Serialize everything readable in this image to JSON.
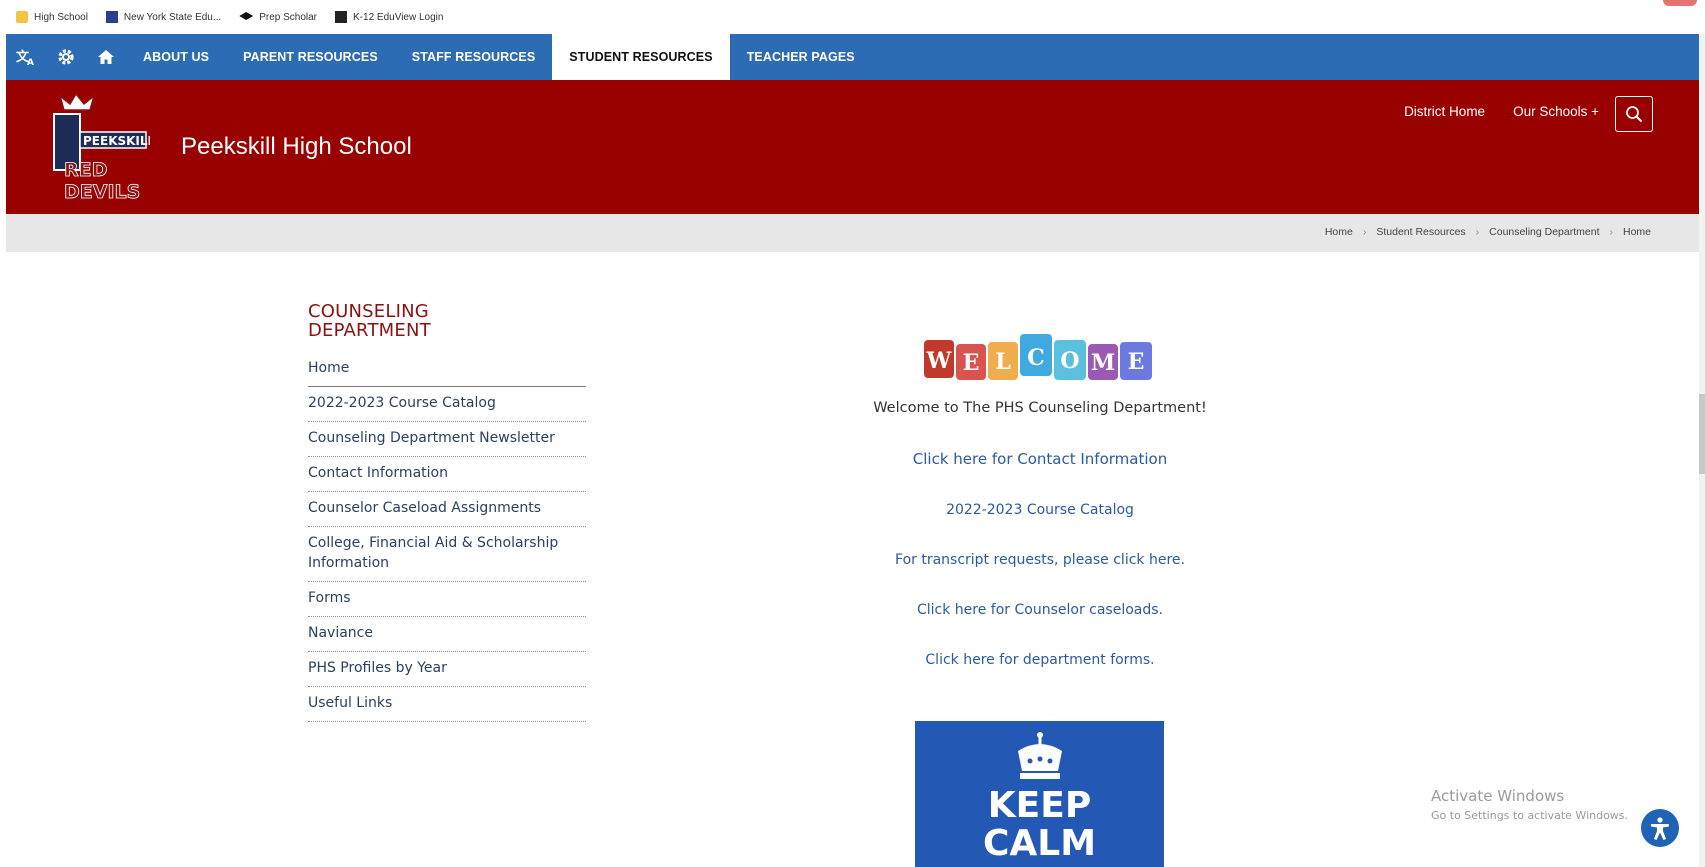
{
  "bookmarks": [
    {
      "label": "High School",
      "icon": "folder-icon"
    },
    {
      "label": "New York State Edu...",
      "icon": "nys-icon"
    },
    {
      "label": "Prep Scholar",
      "icon": "graduation-cap-icon"
    },
    {
      "label": "K-12 EduView Login",
      "icon": "k12-icon"
    }
  ],
  "topnav": {
    "icons": [
      "translate-icon",
      "gear-icon",
      "home-icon"
    ],
    "items": [
      {
        "label": "ABOUT US",
        "active": false
      },
      {
        "label": "PARENT RESOURCES",
        "active": false
      },
      {
        "label": "STAFF RESOURCES",
        "active": false
      },
      {
        "label": "STUDENT RESOURCES",
        "active": true
      },
      {
        "label": "TEACHER PAGES",
        "active": false
      }
    ]
  },
  "header": {
    "title": "Peekskill High School",
    "links": [
      "District Home",
      "Our Schools +"
    ],
    "logo_lines": [
      "PEEKSKILL",
      "RED",
      "DEVILS"
    ],
    "colors": {
      "nav": "#2c6cb5",
      "header": "#990000"
    }
  },
  "breadcrumb": [
    "Home",
    "Student Resources",
    "Counseling Department",
    "Home"
  ],
  "sidebar": {
    "title": "COUNSELING DEPARTMENT",
    "items": [
      "Home",
      "2022-2023 Course Catalog",
      "Counseling Department Newsletter",
      "Contact Information",
      "Counselor Caseload Assignments",
      "College, Financial Aid & Scholarship Information",
      "Forms",
      "Naviance",
      "PHS Profiles by Year",
      "Useful Links"
    ]
  },
  "main": {
    "welcome_letters": [
      "W",
      "E",
      "L",
      "C",
      "O",
      "M",
      "E"
    ],
    "welcome_text": "Welcome to The PHS Counseling Department!",
    "links": [
      "Click here for Contact Information",
      "2022-2023 Course Catalog",
      "For transcript requests, please click here.",
      "Click here for Counselor caseloads.",
      "Click here for department forms."
    ],
    "poster": {
      "line1": "KEEP",
      "line2": "CALM"
    }
  },
  "watermark": {
    "line1": "Activate Windows",
    "line2": "Go to Settings to activate Windows."
  }
}
